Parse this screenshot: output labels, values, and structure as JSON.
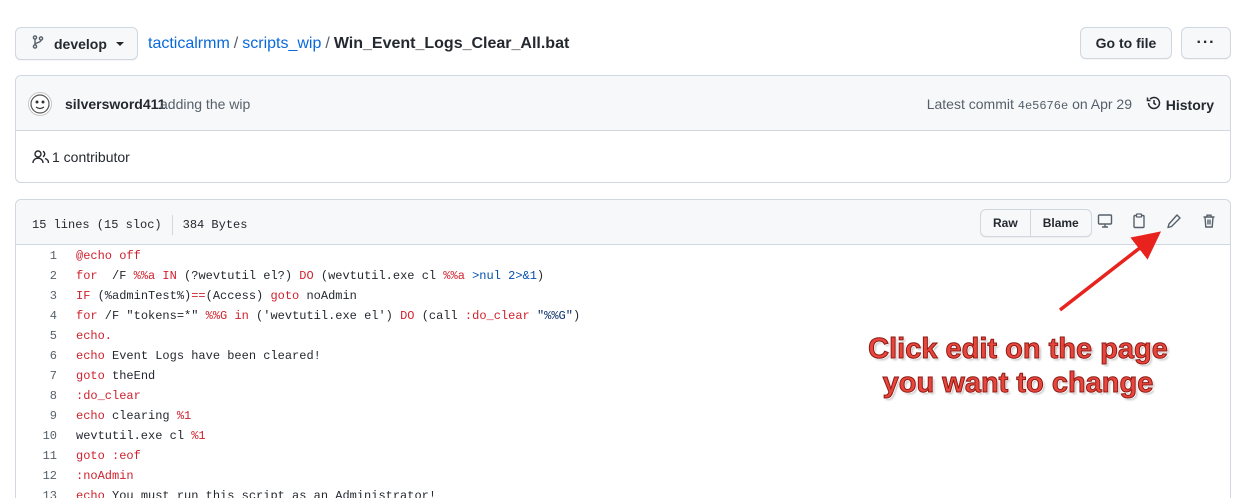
{
  "topbar": {
    "branch": "develop",
    "breadcrumb": {
      "repo": "tacticalrmm",
      "folder": "scripts_wip",
      "file": "Win_Event_Logs_Clear_All.bat",
      "separator": "/"
    },
    "goto_file": "Go to file",
    "more": "···"
  },
  "commit": {
    "author": "silversword411",
    "message": "adding the wip",
    "latest_label": "Latest commit",
    "sha": "4e5676e",
    "date_text": "on Apr 29",
    "history": "History"
  },
  "contributors": {
    "text": "1 contributor"
  },
  "file": {
    "lines_info": "15 lines (15 sloc)",
    "size": "384 Bytes",
    "raw": "Raw",
    "blame": "Blame",
    "icons": [
      "display-icon",
      "copy-icon",
      "pencil-icon",
      "trash-icon"
    ]
  },
  "code_lines": [
    {
      "n": "1",
      "parts": [
        [
          "kw",
          "@echo off"
        ]
      ]
    },
    {
      "n": "2",
      "parts": [
        [
          "kw",
          "for"
        ],
        [
          "",
          "  /F "
        ],
        [
          "kw",
          "%%a"
        ],
        [
          "",
          ""
        ],
        [
          "kw",
          " IN"
        ],
        [
          "",
          " (?wevtutil el?) "
        ],
        [
          "kw",
          "DO"
        ],
        [
          "",
          " (wevtutil.exe cl "
        ],
        [
          "kw",
          "%%a"
        ],
        [
          "",
          ""
        ],
        [
          "fn",
          " >nul 2>&1"
        ],
        [
          "",
          ")"
        ]
      ]
    },
    {
      "n": "3",
      "parts": [
        [
          "kw",
          "IF"
        ],
        [
          "",
          " (%adminTest%)"
        ],
        [
          "kw",
          "=="
        ],
        [
          "",
          "(Access) "
        ],
        [
          "kw",
          "goto"
        ],
        [
          "",
          " noAdmin"
        ]
      ]
    },
    {
      "n": "4",
      "parts": [
        [
          "kw",
          "for"
        ],
        [
          "",
          " /F \"tokens=*\" "
        ],
        [
          "kw",
          "%%G"
        ],
        [
          "kw",
          " in"
        ],
        [
          "",
          " ('wevtutil.exe el') "
        ],
        [
          "kw",
          "DO"
        ],
        [
          "",
          " (call "
        ],
        [
          "kw",
          ":do_clear"
        ],
        [
          "",
          " "
        ],
        [
          "st",
          "\"%%G\""
        ],
        [
          "",
          ")"
        ]
      ]
    },
    {
      "n": "5",
      "parts": [
        [
          "kw",
          "echo."
        ]
      ]
    },
    {
      "n": "6",
      "parts": [
        [
          "kw",
          "echo"
        ],
        [
          "",
          " Event Logs have been cleared!"
        ]
      ]
    },
    {
      "n": "7",
      "parts": [
        [
          "kw",
          "goto"
        ],
        [
          "",
          " theEnd"
        ]
      ]
    },
    {
      "n": "8",
      "parts": [
        [
          "kw",
          ":do_clear"
        ]
      ]
    },
    {
      "n": "9",
      "parts": [
        [
          "kw",
          "echo"
        ],
        [
          "",
          " clearing "
        ],
        [
          "kw",
          "%1"
        ]
      ]
    },
    {
      "n": "10",
      "parts": [
        [
          "",
          "wevtutil.exe cl "
        ],
        [
          "kw",
          "%1"
        ]
      ]
    },
    {
      "n": "11",
      "parts": [
        [
          "kw",
          "goto"
        ],
        [
          "kw",
          " :eof"
        ]
      ]
    },
    {
      "n": "12",
      "parts": [
        [
          "kw",
          ":noAdmin"
        ]
      ]
    },
    {
      "n": "13",
      "parts": [
        [
          "kw",
          "echo"
        ],
        [
          "",
          " You must run this script as an Administrator!"
        ]
      ]
    }
  ],
  "annotation": {
    "line1": "Click edit on the page",
    "line2": "you want to change",
    "color": "#e8463c"
  }
}
